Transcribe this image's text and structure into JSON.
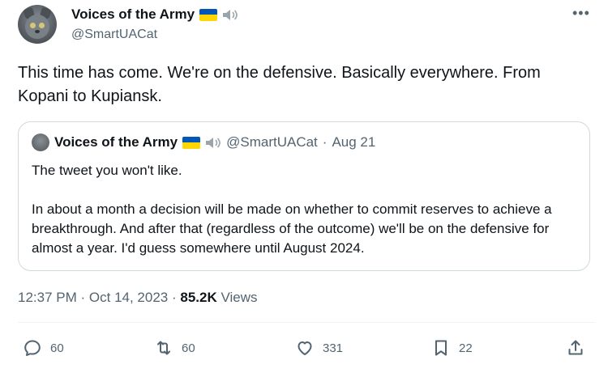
{
  "author": {
    "name": "Voices of the Army",
    "handle": "@SmartUACat",
    "avatar_icon": "cat-avatar-icon",
    "flag_icon": "ukraine-flag-icon",
    "speaker_icon": "speaker-icon"
  },
  "more_label": "•••",
  "tweet": {
    "text": "This time has come. We're on the defensive. Basically everywhere. From Kopani to Kupiansk."
  },
  "quote": {
    "name": "Voices of the Army",
    "handle": "@SmartUACat",
    "separator": "·",
    "date": "Aug 21",
    "paragraphs": [
      "The tweet you won't like.",
      "In about a month a decision will be made on whether to commit reserves to achieve a breakthrough. And after that (regardless of the outcome) we'll be on the defensive for almost a year. I'd guess somewhere until August 2024."
    ]
  },
  "meta": {
    "time": "12:37 PM",
    "separator": "·",
    "date": "Oct 14, 2023",
    "views_count": "85.2K",
    "views_label": "Views"
  },
  "actions": {
    "replies": "60",
    "reposts": "60",
    "likes": "331",
    "bookmarks": "22"
  },
  "colors": {
    "text": "#0f1419",
    "secondary": "#536471",
    "border": "#cfd9de",
    "flag_blue": "#0057b7",
    "flag_yellow": "#ffd700"
  }
}
